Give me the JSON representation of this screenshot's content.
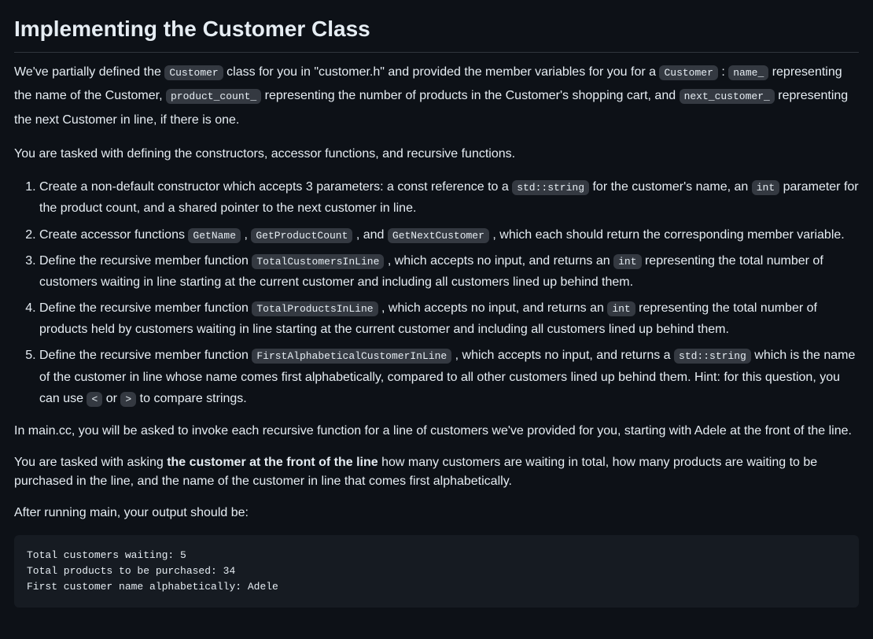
{
  "title": "Implementing the Customer Class",
  "intro": {
    "p1_a": "We've partially defined the ",
    "code_customer": "Customer",
    "p1_b": " class for you in \"customer.h\" and provided the member variables for you for a ",
    "code_customer2": "Customer",
    "p1_c": " : ",
    "code_name": "name_",
    "p1_d": " representing the name of the Customer, ",
    "code_product_count": "product_count_",
    "p1_e": " representing the number of products in the Customer's shopping cart, and ",
    "code_next_customer": "next_customer_",
    "p1_f": " representing the next Customer in line, if there is one."
  },
  "task_intro": "You are tasked with defining the constructors, accessor functions, and recursive functions.",
  "steps": {
    "s1_a": "Create a non-default constructor which accepts 3 parameters: a const reference to a ",
    "s1_code1": "std::string",
    "s1_b": " for the customer's name, an ",
    "s1_code2": "int",
    "s1_c": " parameter for the product count, and a shared pointer to the next customer in line.",
    "s2_a": "Create accessor functions ",
    "s2_code1": "GetName",
    "s2_b": " , ",
    "s2_code2": "GetProductCount",
    "s2_c": " , and ",
    "s2_code3": "GetNextCustomer",
    "s2_d": " , which each should return the corresponding member variable.",
    "s3_a": "Define the recursive member function ",
    "s3_code1": "TotalCustomersInLine",
    "s3_b": " , which accepts no input, and returns an ",
    "s3_code2": "int",
    "s3_c": " representing the total number of customers waiting in line starting at the current customer and including all customers lined up behind them.",
    "s4_a": "Define the recursive member function ",
    "s4_code1": "TotalProductsInLine",
    "s4_b": " , which accepts no input, and returns an ",
    "s4_code2": "int",
    "s4_c": " representing the total number of products held by customers waiting in line starting at the current customer and including all customers lined up behind them.",
    "s5_a": "Define the recursive member function ",
    "s5_code1": "FirstAlphabeticalCustomerInLine",
    "s5_b": " , which accepts no input, and returns a ",
    "s5_code2": "std::string",
    "s5_c": " which is the name of the customer in line whose name comes first alphabetically, compared to all other customers lined up behind them. Hint: for this question, you can use ",
    "s5_code3": "<",
    "s5_d": " or ",
    "s5_code4": ">",
    "s5_e": " to compare strings."
  },
  "main_para": "In main.cc, you will be asked to invoke each recursive function for a line of customers we've provided for you, starting with Adele at the front of the line.",
  "task2_a": "You are tasked with asking ",
  "task2_bold": "the customer at the front of the line",
  "task2_b": " how many customers are waiting in total, how many products are waiting to be purchased in the line, and the name of the customer in line that comes first alphabetically.",
  "output_intro": "After running main, your output should be:",
  "output_block": "Total customers waiting: 5\nTotal products to be purchased: 34\nFirst customer name alphabetically: Adele"
}
